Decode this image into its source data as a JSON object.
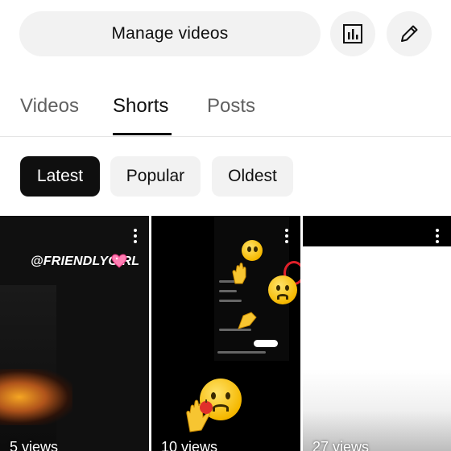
{
  "header": {
    "manage_label": "Manage videos"
  },
  "tabs": [
    {
      "label": "Videos",
      "active": false
    },
    {
      "label": "Shorts",
      "active": true
    },
    {
      "label": "Posts",
      "active": false
    }
  ],
  "chips": [
    {
      "label": "Latest",
      "selected": true
    },
    {
      "label": "Popular",
      "selected": false
    },
    {
      "label": "Oldest",
      "selected": false
    }
  ],
  "shorts": [
    {
      "views": "5 views",
      "overlay_text": "@FRIENDLYGIRL"
    },
    {
      "views": "10 views"
    },
    {
      "views": "27 views"
    }
  ],
  "colors": {
    "chip_selected_bg": "#0f0f0f",
    "chip_bg": "#f2f2f2",
    "tab_active": "#0f0f0f",
    "tab_inactive": "#606060"
  },
  "icons": {
    "analytics": "bar-chart-icon",
    "edit": "pencil-icon",
    "more": "more-vert-icon"
  }
}
